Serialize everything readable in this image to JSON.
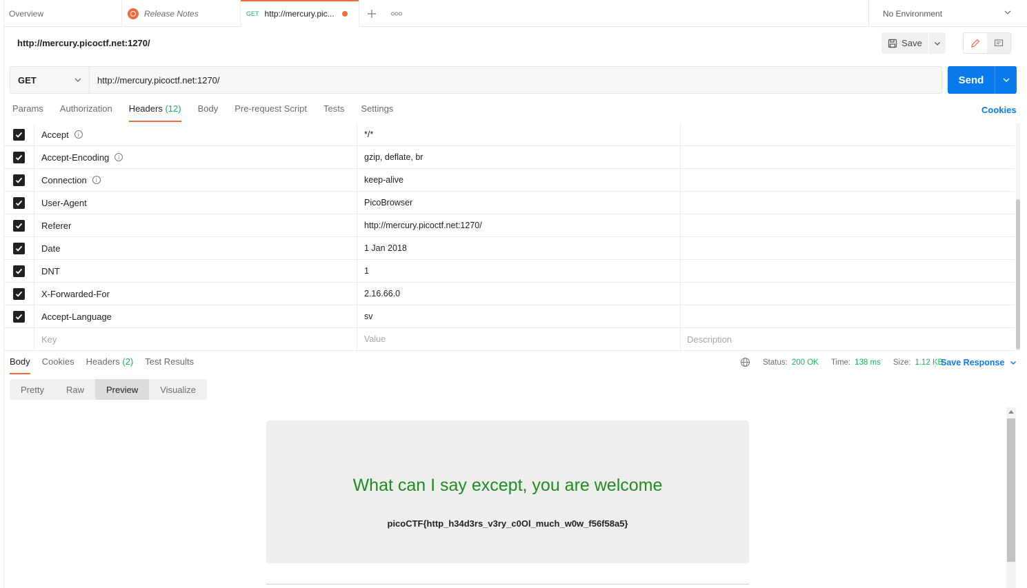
{
  "tabs": [
    {
      "label": "Overview"
    },
    {
      "label": "Release Notes"
    },
    {
      "method": "GET",
      "label": "http://mercury.pic..."
    }
  ],
  "environment": {
    "label": "No Environment"
  },
  "request": {
    "title": "http://mercury.picoctf.net:1270/",
    "method": "GET",
    "url": "http://mercury.picoctf.net:1270/",
    "save_label": "Save",
    "send_label": "Send"
  },
  "request_tabs": {
    "params": "Params",
    "authorization": "Authorization",
    "headers": "Headers",
    "headers_count": "(12)",
    "body": "Body",
    "prerequest": "Pre-request Script",
    "tests": "Tests",
    "settings": "Settings",
    "cookies": "Cookies"
  },
  "headers": [
    {
      "key": "Accept",
      "value": "*/*",
      "info": true
    },
    {
      "key": "Accept-Encoding",
      "value": "gzip, deflate, br",
      "info": true
    },
    {
      "key": "Connection",
      "value": "keep-alive",
      "info": true
    },
    {
      "key": "User-Agent",
      "value": "PicoBrowser",
      "info": false
    },
    {
      "key": "Referer",
      "value": "http://mercury.picoctf.net:1270/",
      "info": false
    },
    {
      "key": "Date",
      "value": "1 Jan 2018",
      "info": false
    },
    {
      "key": "DNT",
      "value": "1",
      "info": false
    },
    {
      "key": "X-Forwarded-For",
      "value": "2.16.66.0",
      "info": false
    },
    {
      "key": "Accept-Language",
      "value": "sv",
      "info": false
    }
  ],
  "headers_placeholder": {
    "key": "Key",
    "value": "Value",
    "description": "Description"
  },
  "response_tabs": {
    "body": "Body",
    "cookies": "Cookies",
    "headers": "Headers",
    "headers_count": "(2)",
    "test_results": "Test Results"
  },
  "response_meta": {
    "status_label": "Status:",
    "status": "200 OK",
    "time_label": "Time:",
    "time": "138 ms",
    "size_label": "Size:",
    "size": "1.12 KB",
    "save_response": "Save Response"
  },
  "view_modes": [
    "Pretty",
    "Raw",
    "Preview",
    "Visualize"
  ],
  "preview": {
    "heading": "What can I say except, you are welcome",
    "flag": "picoCTF{http_h34d3rs_v3ry_c0Ol_much_w0w_f56f58a5}"
  },
  "colors": {
    "accent_orange": "#f26b3a",
    "send_blue": "#097bed",
    "status_green": "#0cbb52",
    "preview_green": "#1e8c1e"
  }
}
